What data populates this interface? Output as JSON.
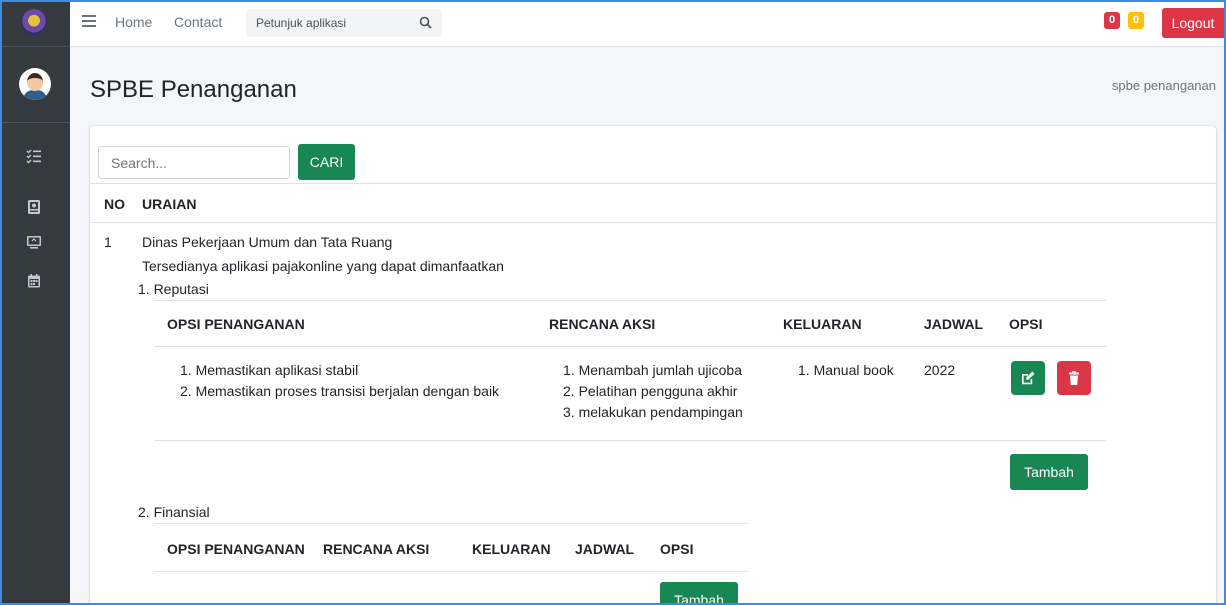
{
  "navbar": {
    "home": "Home",
    "contact": "Contact",
    "search_placeholder": "Petunjuk aplikasi",
    "badge_red": "0",
    "badge_yellow": "0",
    "logout": "Logout"
  },
  "page": {
    "title": "SPBE Penanganan",
    "breadcrumb": "spbe penanganan"
  },
  "search": {
    "placeholder": "Search...",
    "button": "CARI"
  },
  "table": {
    "headers": [
      "NO",
      "URAIAN"
    ],
    "rows": [
      {
        "no": "1",
        "dinas": "Dinas Pekerjaan Umum dan Tata Ruang",
        "uraian": "Tersedianya aplikasi pajakonline yang dapat dimanfaatkan",
        "sections": [
          {
            "title": "1. Reputasi",
            "headers": [
              "OPSI PENANGANAN",
              "RENCANA AKSI",
              "KELUARAN",
              "JADWAL",
              "OPSI"
            ],
            "row": {
              "opsi_penanganan": [
                "1. Memastikan aplikasi stabil",
                "2. Memastikan proses transisi berjalan dengan baik"
              ],
              "rencana_aksi": [
                "1. Menambah jumlah ujicoba",
                "2. Pelatihan pengguna akhir",
                "3. melakukan pendampingan"
              ],
              "keluaran": [
                "1. Manual book"
              ],
              "jadwal": "2022"
            },
            "add_button": "Tambah"
          },
          {
            "title": "2. Finansial",
            "headers": [
              "OPSI PENANGANAN",
              "RENCANA AKSI",
              "KELUARAN",
              "JADWAL",
              "OPSI"
            ],
            "add_button": "Tambah"
          }
        ]
      }
    ]
  },
  "colors": {
    "sidebar": "#343a40",
    "success": "#198754",
    "danger": "#dc3545",
    "warning": "#ffc107"
  },
  "icons": {
    "sidebar": [
      "list-check-icon",
      "book-icon",
      "monitor-icon",
      "calendar-icon"
    ],
    "edit": "edit-icon",
    "delete": "trash-icon"
  }
}
